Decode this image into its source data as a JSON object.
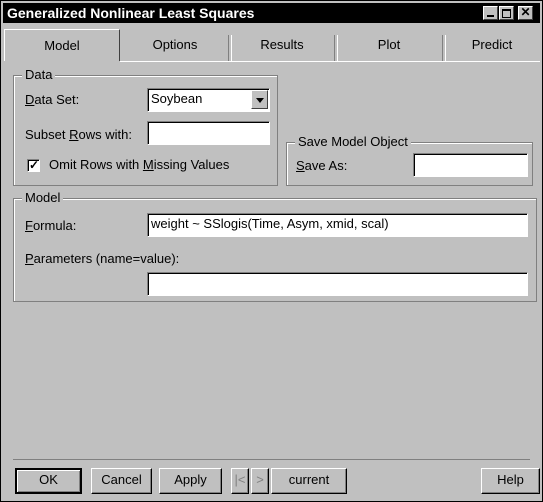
{
  "window": {
    "title": "Generalized Nonlinear Least Squares",
    "title_buttons": {
      "minimize_glyph": "",
      "maximize_glyph": "",
      "close_glyph": "✕"
    }
  },
  "tabs": [
    {
      "label": "Model",
      "active": true
    },
    {
      "label": "Options",
      "active": false
    },
    {
      "label": "Results",
      "active": false
    },
    {
      "label": "Plot",
      "active": false
    },
    {
      "label": "Predict",
      "active": false
    }
  ],
  "data_group": {
    "legend": "Data",
    "data_set_label_pre": "",
    "data_set_label_key": "D",
    "data_set_label_post": "ata Set:",
    "data_set_value": "Soybean",
    "subset_label_pre": "Subset ",
    "subset_label_key": "R",
    "subset_label_post": "ows with:",
    "subset_value": "",
    "omit_checked": true,
    "omit_label_pre": "Omit Rows with ",
    "omit_label_key": "M",
    "omit_label_post": "issing Values"
  },
  "save_group": {
    "legend": "Save Model Object",
    "save_as_label_pre": "",
    "save_as_label_key": "S",
    "save_as_label_post": "ave As:",
    "save_as_value": ""
  },
  "model_group": {
    "legend": "Model",
    "formula_label_pre": "",
    "formula_label_key": "F",
    "formula_label_post": "ormula:",
    "formula_value": "weight ~ SSlogis(Time, Asym, xmid, scal)",
    "parameters_label_pre": "",
    "parameters_label_key": "P",
    "parameters_label_post": "arameters (name=value):",
    "parameters_value": ""
  },
  "footer": {
    "ok": "OK",
    "cancel": "Cancel",
    "apply": "Apply",
    "prev": "|<",
    "next": ">",
    "current": "current",
    "help": "Help"
  },
  "colors": {
    "dialog_bg": "#c0c0c0",
    "title_bg": "#000000",
    "title_fg": "#ffffff"
  }
}
